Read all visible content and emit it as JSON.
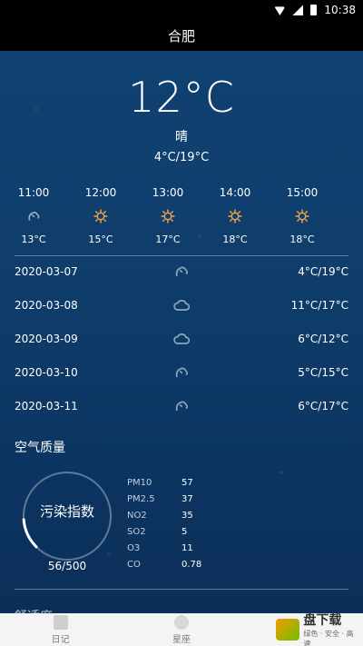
{
  "status_bar": {
    "time": "10:38"
  },
  "header": {
    "title": "合肥"
  },
  "current": {
    "temperature": "12°C",
    "condition": "晴",
    "range": "4°C/19°C"
  },
  "hourly": [
    {
      "time": "11:00",
      "icon": "cloudy-icon",
      "temp": "13°C"
    },
    {
      "time": "12:00",
      "icon": "sun-icon",
      "temp": "15°C"
    },
    {
      "time": "13:00",
      "icon": "sun-icon",
      "temp": "17°C"
    },
    {
      "time": "14:00",
      "icon": "sun-icon",
      "temp": "18°C"
    },
    {
      "time": "15:00",
      "icon": "sun-icon",
      "temp": "18°C"
    }
  ],
  "daily": [
    {
      "date": "2020-03-07",
      "icon": "cloudy-icon",
      "range": "4°C/19°C"
    },
    {
      "date": "2020-03-08",
      "icon": "cloud-icon",
      "range": "11°C/17°C"
    },
    {
      "date": "2020-03-09",
      "icon": "cloud-icon",
      "range": "6°C/12°C"
    },
    {
      "date": "2020-03-10",
      "icon": "cloudy-icon",
      "range": "5°C/15°C"
    },
    {
      "date": "2020-03-11",
      "icon": "cloudy-icon",
      "range": "6°C/17°C"
    }
  ],
  "air_quality": {
    "title": "空气质量",
    "index_label": "污染指数",
    "index_value": "56/500",
    "index_fraction": 0.112,
    "pollutants": [
      {
        "name": "PM10",
        "value": "57"
      },
      {
        "name": "PM2.5",
        "value": "37"
      },
      {
        "name": "NO2",
        "value": "35"
      },
      {
        "name": "SO2",
        "value": "5"
      },
      {
        "name": "O3",
        "value": "11"
      },
      {
        "name": "CO",
        "value": "0.78"
      }
    ]
  },
  "comfort": {
    "title": "舒适度"
  },
  "nav": {
    "items": [
      {
        "label": "日记",
        "icon": "diary-icon"
      },
      {
        "label": "星座",
        "icon": "constellation-icon"
      }
    ]
  },
  "watermark": {
    "brand": "盘下载",
    "tagline": "绿色 · 安全 · 高速"
  }
}
